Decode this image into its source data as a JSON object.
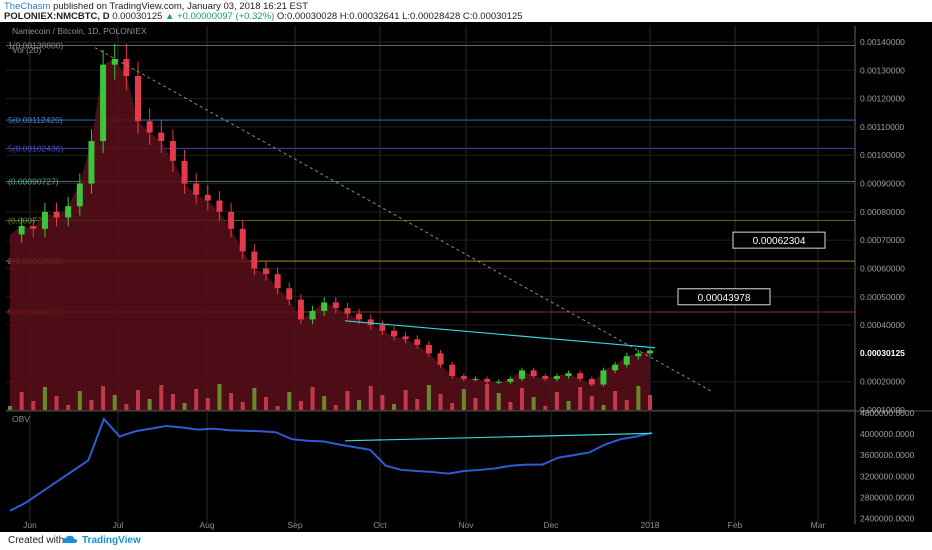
{
  "header": {
    "author": "TheChasm",
    "published": "published on TradingView.com, January 03, 2018 16:21 EST",
    "symbol_line_prefix": "POLONIEX:NMCBTC, D",
    "last": "0.00030125",
    "change": "▲ +0.00000097 (+0.32%)",
    "ohlc": "O:0.00030028 H:0.00032641 L:0.00028428 C:0.00030125"
  },
  "footer": {
    "created_with": "Created with",
    "brand": "TradingView"
  },
  "chart_data": [
    {
      "type": "candlestick",
      "title": "Namecoin / Bitcoin, 1D, POLONIEX",
      "x": [
        "Jun",
        "Jul",
        "Aug",
        "Sep",
        "Oct",
        "Nov",
        "Dec",
        "2018",
        "Feb",
        "Mar"
      ],
      "y_ticks": [
        "0.00140000",
        "0.00130000",
        "0.00120000",
        "0.00110000",
        "0.00100000",
        "0.00090000",
        "0.00080000",
        "0.00070000",
        "0.00060000",
        "0.00050000",
        "0.00040000",
        "0.00020000",
        "0.00010000"
      ],
      "ylim": [
        0.0001,
        0.0014
      ],
      "last_price": "0.00030125",
      "indicator_label": "Vol (20)",
      "fib_levels": [
        {
          "label": "1(0.00138800)",
          "value": 0.001388
        },
        {
          "label": "5(0.00112420)",
          "value": 0.0011242
        },
        {
          "label": "5(0.00102436)",
          "value": 0.00102436
        },
        {
          "label": "(0.00090727)",
          "value": 0.00090727
        },
        {
          "label": "(0.00077)",
          "value": 0.00077
        },
        {
          "label": "2(0.00062620)",
          "value": 0.0006262
        },
        {
          "label": "5(0.00044623)",
          "value": 0.00044623
        }
      ],
      "callouts": [
        "0.00062304",
        "0.00043978"
      ],
      "price_path": [
        0.00072,
        0.00075,
        0.00074,
        0.0008,
        0.00078,
        0.00082,
        0.0009,
        0.00105,
        0.00132,
        0.00134,
        0.00128,
        0.00112,
        0.00108,
        0.00105,
        0.00098,
        0.0009,
        0.00086,
        0.00084,
        0.0008,
        0.00074,
        0.00066,
        0.0006,
        0.00058,
        0.00053,
        0.00049,
        0.00042,
        0.00045,
        0.00048,
        0.00046,
        0.00044,
        0.00042,
        0.0004,
        0.00038,
        0.00036,
        0.00035,
        0.00033,
        0.0003,
        0.00026,
        0.00022,
        0.00021,
        0.00021,
        0.0002,
        0.0002,
        0.00021,
        0.00024,
        0.00022,
        0.00021,
        0.00022,
        0.00023,
        0.00021,
        0.00019,
        0.00024,
        0.00026,
        0.00029,
        0.0003,
        0.00031
      ]
    },
    {
      "type": "line",
      "indicator_label": "OBV",
      "x": [
        "Jun",
        "Jul",
        "Aug",
        "Sep",
        "Oct",
        "Nov",
        "Dec",
        "2018",
        "Feb",
        "Mar"
      ],
      "y_ticks": [
        "4000000.0000",
        "3600000.0000",
        "3200000.0000",
        "2800000.0000",
        "2400000.0000",
        "4800000.0000"
      ],
      "ylim": [
        2300000,
        4300000
      ],
      "values": [
        2550000,
        2700000,
        2900000,
        3100000,
        3300000,
        3500000,
        4280000,
        3950000,
        4050000,
        4100000,
        4150000,
        4120000,
        4080000,
        4100000,
        4070000,
        4060000,
        4050000,
        4030000,
        3900000,
        3870000,
        3860000,
        3800000,
        3750000,
        3700000,
        3400000,
        3320000,
        3300000,
        3280000,
        3250000,
        3300000,
        3320000,
        3350000,
        3400000,
        3420000,
        3420000,
        3550000,
        3600000,
        3650000,
        3800000,
        3900000,
        3950000,
        4020000
      ]
    }
  ]
}
